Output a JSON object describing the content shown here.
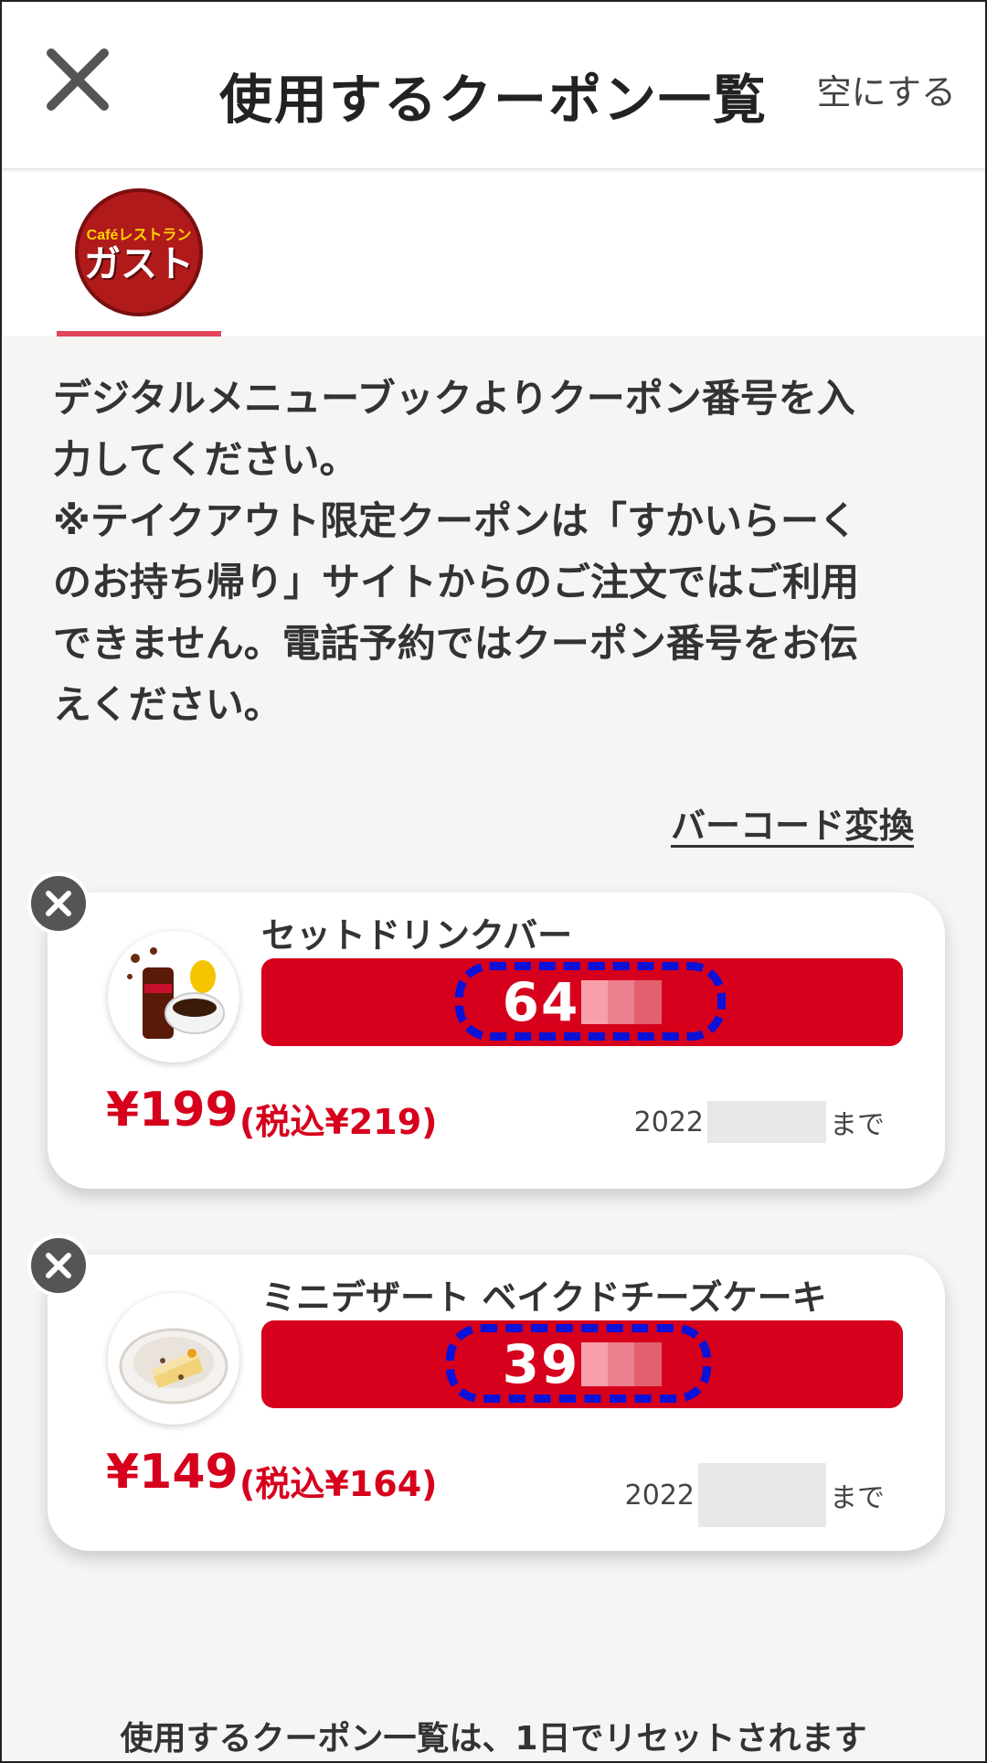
{
  "header": {
    "title": "使用するクーポン一覧",
    "clear_label": "空にする",
    "close_icon": "close-icon"
  },
  "brand": {
    "logo_top": "Caféレストラン",
    "logo_name": "ガスト",
    "accent": "#e2445a"
  },
  "notice": "デジタルメニューブックよりクーポン番号を入\n力してください。\n※テイクアウト限定クーポンは「すかいらーく\nのお持ち帰り」サイトからのご注文ではご利用\nできません。電話予約ではクーポン番号をお伝\nえください。",
  "barcode_link": "バーコード変換",
  "coupons": [
    {
      "name": "セットドリンクバー",
      "code_visible": "64",
      "price": "¥199",
      "price_tax": "(税込¥219)",
      "expiry_prefix": "2022",
      "expiry_suffix": "まで"
    },
    {
      "name": "ミニデザート ベイクドチーズケーキ",
      "code_visible": "39",
      "price": "¥149",
      "price_tax": "(税込¥164)",
      "expiry_prefix": "2022",
      "expiry_suffix": "まで"
    }
  ],
  "footer_note": "使用するクーポン一覧は、1日でリセットされます",
  "colors": {
    "code_bar": "#d6001c",
    "price": "#d6001c",
    "annotation": "#0a12d8"
  }
}
